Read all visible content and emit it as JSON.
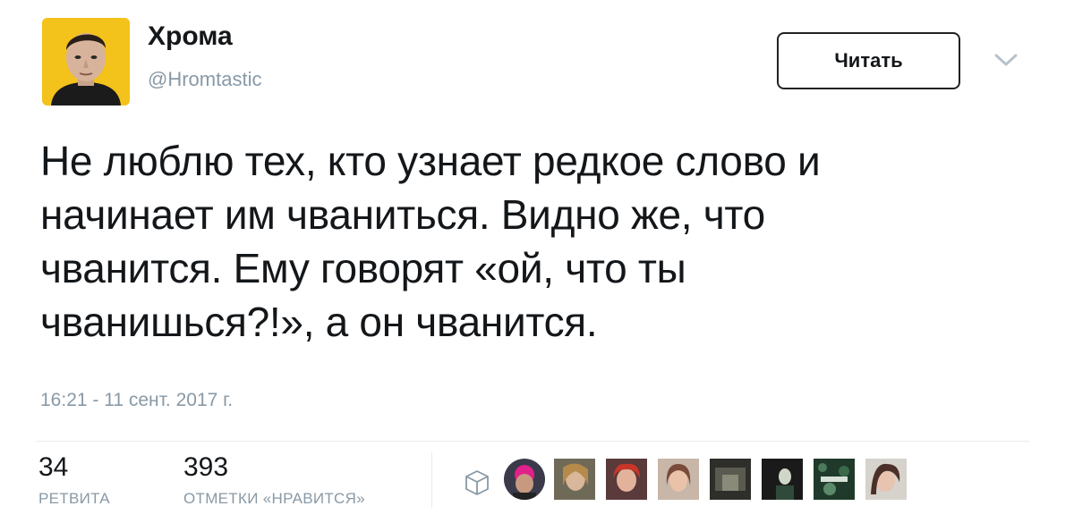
{
  "author": {
    "name": "Хрома",
    "handle": "@Hromtastic"
  },
  "follow_button": {
    "label": "Читать"
  },
  "icons": {
    "menu": "chevron-down-icon",
    "embed": "box-outline-icon"
  },
  "tweet": {
    "lines": [
      "Не люблю тех, кто узнает редкое слово и",
      "начинает им чваниться. Видно же, что",
      "чванится. Ему говорят «ой, что ты",
      "чванишься?!», а он чванится."
    ],
    "timestamp": "16:21 - 11 сент. 2017 г."
  },
  "stats": {
    "retweets": {
      "count": "34",
      "label": "РЕТВИТА"
    },
    "likes": {
      "count": "393",
      "label": "ОТМЕТКИ «НРАВИТСЯ»"
    }
  },
  "colors": {
    "text": "#14171a",
    "secondary": "#8899a6",
    "divider": "#e6ecf0",
    "avatar_bg": "#f3c21b"
  }
}
